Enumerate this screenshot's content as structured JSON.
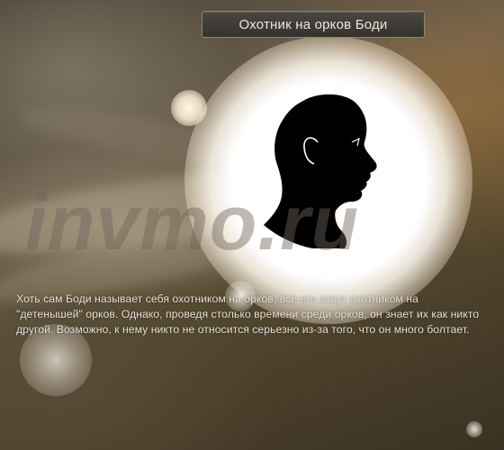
{
  "title": "Охотник на орков Боди",
  "description": "Хоть сам Боди называет себя охотником на орков, все его зовут охотником на \"детенышей\" орков. Однако, проведя столько времени среди орков, он знает их как никто другой. Возможно, к нему никто не относится серьезно из-за того, что он много болтает.",
  "watermark": "invmo.ru",
  "portrait": {
    "icon": "head-silhouette-icon",
    "colors": {
      "silhouette": "#000000",
      "glow": "#ffffff"
    }
  }
}
